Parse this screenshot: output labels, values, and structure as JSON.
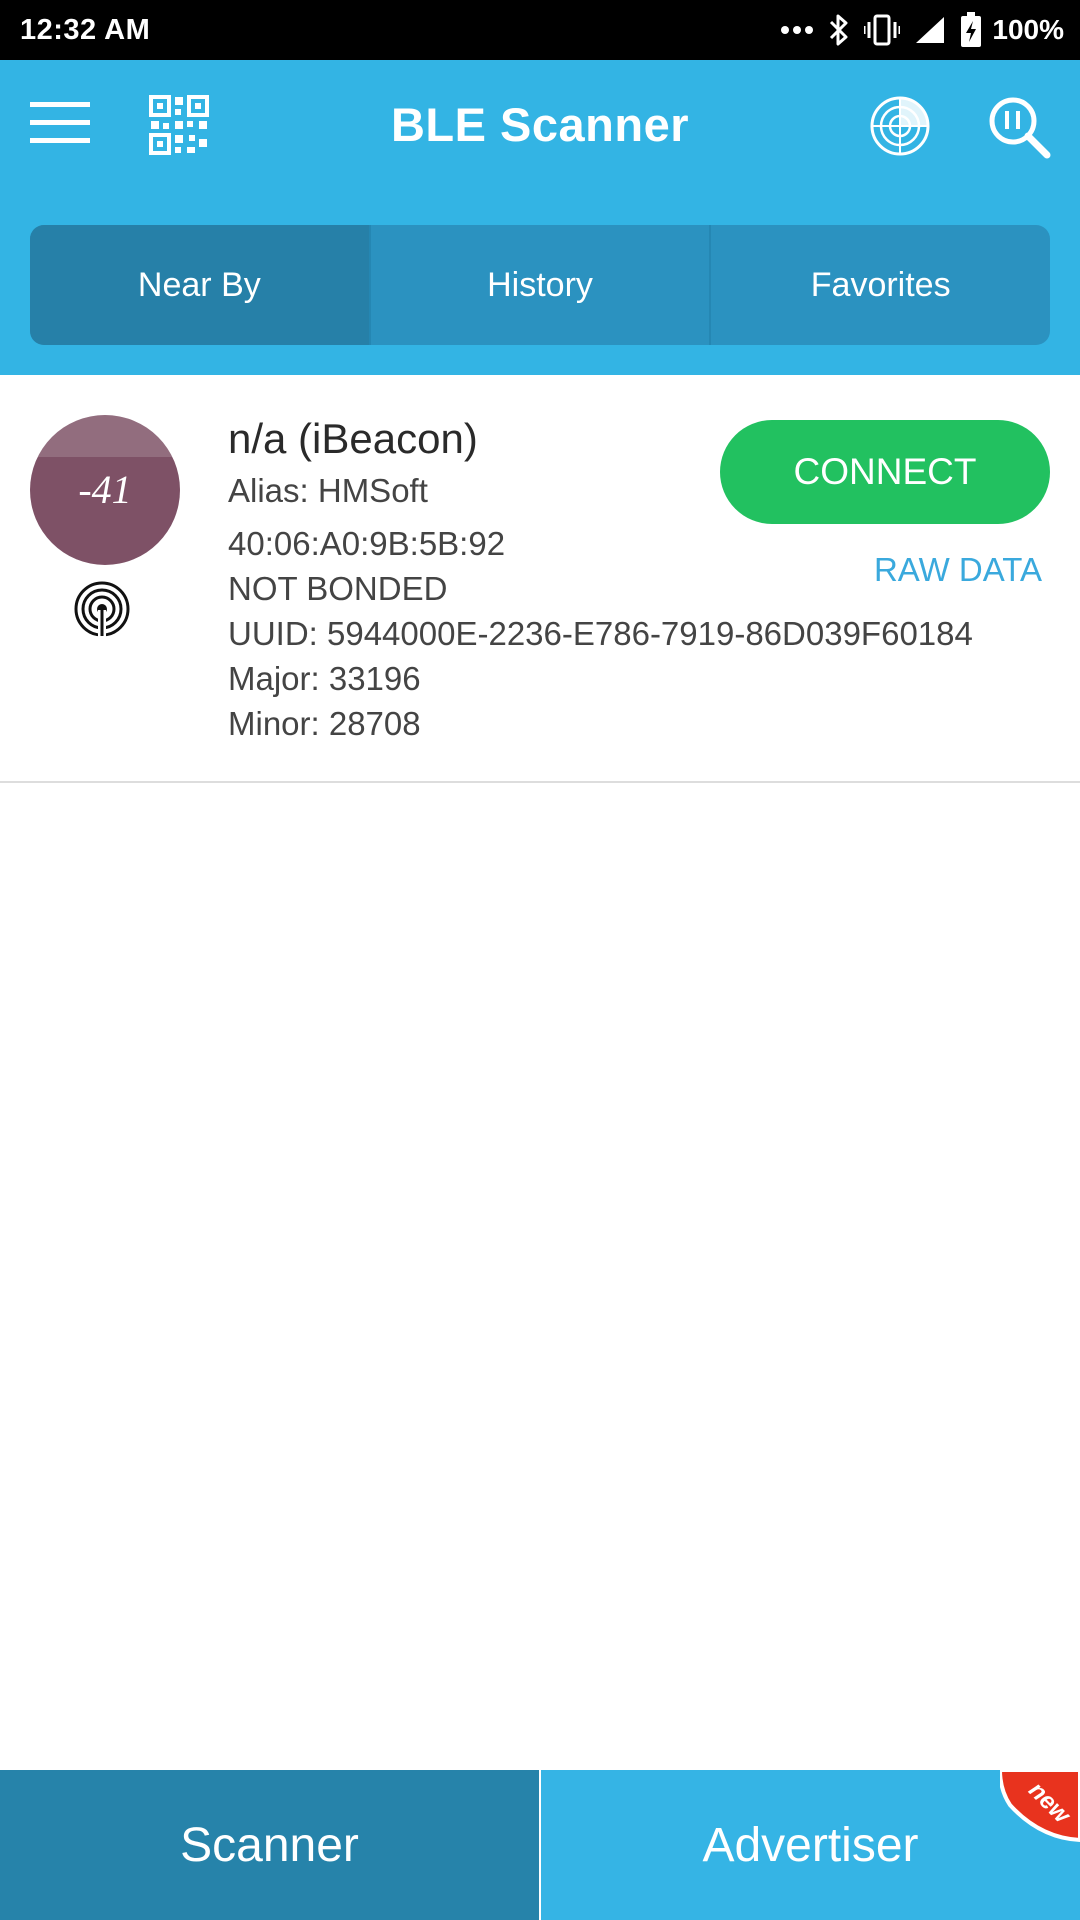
{
  "status_bar": {
    "time": "12:32 AM",
    "battery_percent": "100%",
    "icons": [
      "more-dots-icon",
      "bluetooth-icon",
      "vibrate-icon",
      "signal-icon",
      "battery-charging-icon"
    ]
  },
  "app_bar": {
    "title": "BLE Scanner",
    "left_icons": [
      "menu-icon",
      "qr-code-icon"
    ],
    "right_icons": [
      "radar-icon",
      "search-icon"
    ],
    "color": "#33b4e4"
  },
  "tabs": [
    {
      "label": "Near By",
      "active": true
    },
    {
      "label": "History",
      "active": false
    },
    {
      "label": "Favorites",
      "active": false
    }
  ],
  "devices": [
    {
      "rssi": "-41",
      "name": "n/a (iBeacon)",
      "alias": "Alias: HMSoft",
      "mac": "40:06:A0:9B:5B:92",
      "bond_state": "NOT BONDED",
      "uuid": "UUID: 5944000E-2236-E786-7919-86D039F60184",
      "major": "Major: 33196",
      "minor": "Minor: 28708",
      "connect_label": "CONNECT",
      "raw_data_label": "RAW DATA",
      "badge_color": "#7e5166",
      "connect_color": "#22c160",
      "icon": "ibeacon-icon"
    }
  ],
  "bottom_nav": {
    "scanner_label": "Scanner",
    "advertiser_label": "Advertiser",
    "new_badge": "new",
    "active": "Scanner"
  }
}
